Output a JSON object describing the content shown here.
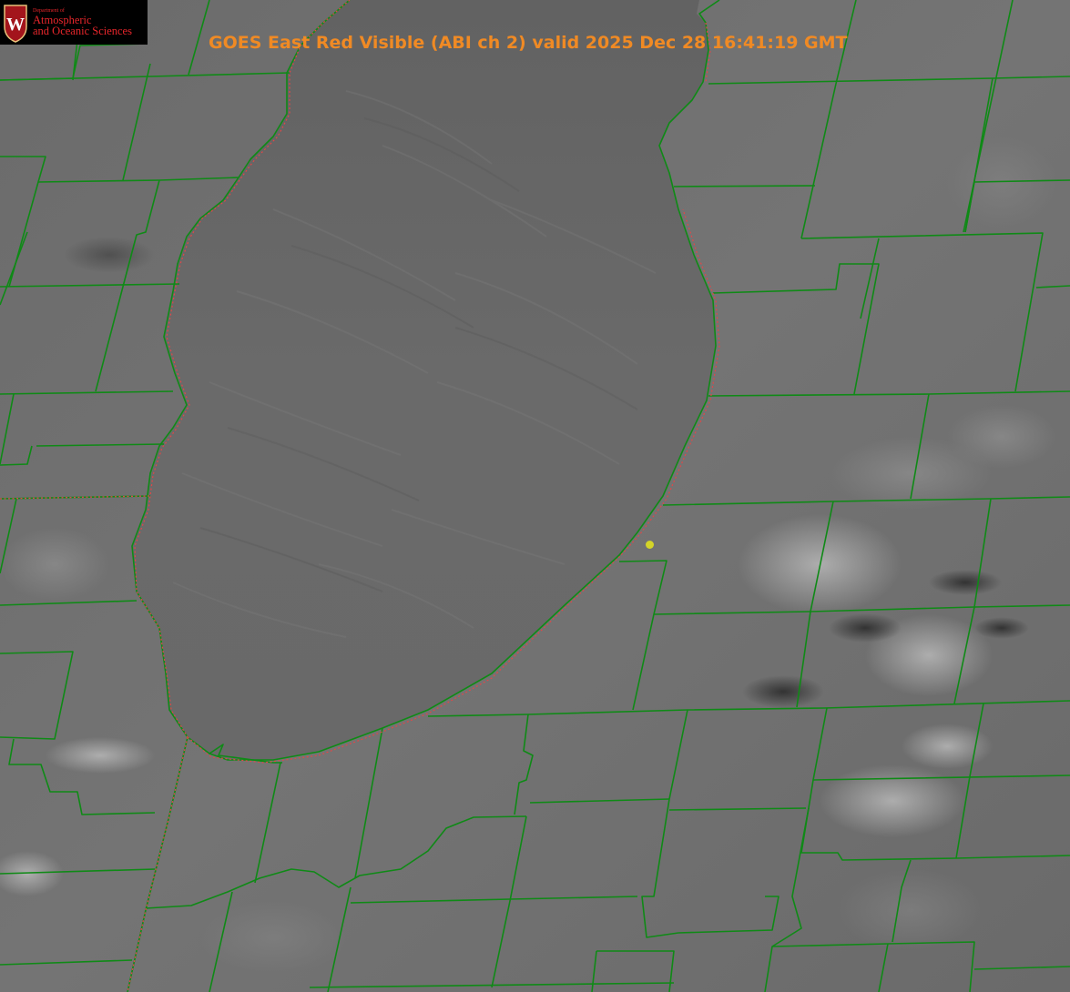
{
  "title": "GOES East Red Visible (ABI ch 2) valid 2025 Dec 28 16:41:19 GMT",
  "logo": {
    "department": "Department of",
    "line1": "Atmospheric",
    "line2": "and Oceanic Sciences",
    "crest_letter": "W"
  },
  "colors": {
    "title": "#f08a24",
    "county_lines": "#0f8a16",
    "state_line": "#e04848",
    "marker": "#d4d428",
    "logo_text": "#e8262b",
    "crest": "#a3151c"
  },
  "icons": {
    "logo": "university-crest-icon",
    "marker": "location-dot-icon"
  }
}
